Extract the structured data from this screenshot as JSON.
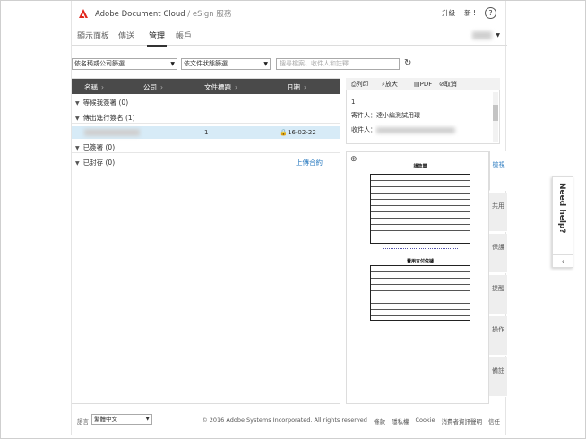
{
  "header": {
    "brand": "Adobe Document Cloud",
    "brand_sub": " / eSign 服務",
    "upgrade": "升級",
    "notify": "新 !",
    "help": "?"
  },
  "nav": {
    "tabs": [
      {
        "label": "顯示面板",
        "active": false
      },
      {
        "label": "傳送",
        "active": false
      },
      {
        "label": "管理",
        "active": true
      },
      {
        "label": "帳戶",
        "active": false
      }
    ]
  },
  "filters": {
    "by_name": "依名稱或公司篩選",
    "by_status": "依文件狀態篩選",
    "search_placeholder": "搜尋檔案、收件人和註釋"
  },
  "table": {
    "columns": [
      "名稱",
      "公司",
      "文件標題",
      "日期"
    ],
    "groups": [
      {
        "label": "等候我簽署 (0)"
      },
      {
        "label": "傳出進行簽名 (1)"
      },
      {
        "label": "已簽署 (0)"
      },
      {
        "label": "已封存 (0)",
        "action": "上傳合約"
      }
    ],
    "selected_row": {
      "title": "1",
      "date": "16-02-22"
    }
  },
  "preview": {
    "toolbar": {
      "print": "列印",
      "zoom": "放大",
      "pdf": "PDF",
      "cancel": "取消"
    },
    "info": {
      "title": "1",
      "sender_label": "寄件人：",
      "sender": "達小編測試用環",
      "recipient_label": "收件人："
    },
    "doc1_title": "請款單",
    "doc2_title": "費用支付依據",
    "side_tabs": [
      "檢視",
      "共用",
      "保護",
      "提醒",
      "操作",
      "備註"
    ]
  },
  "footer": {
    "lang_label": "語言",
    "lang": "繁體中文",
    "copyright": "© 2016 Adobe Systems Incorporated. All rights reserved",
    "links": [
      "條款",
      "隱私權",
      "Cookie",
      "消費者資訊聲明",
      "信任"
    ]
  },
  "need_help": "Need help?",
  "colors": {
    "header_dark": "#4a4a4a",
    "link": "#2b7bc0",
    "selected_row": "#d7ebf7",
    "adobe_red": "#e1251b"
  }
}
